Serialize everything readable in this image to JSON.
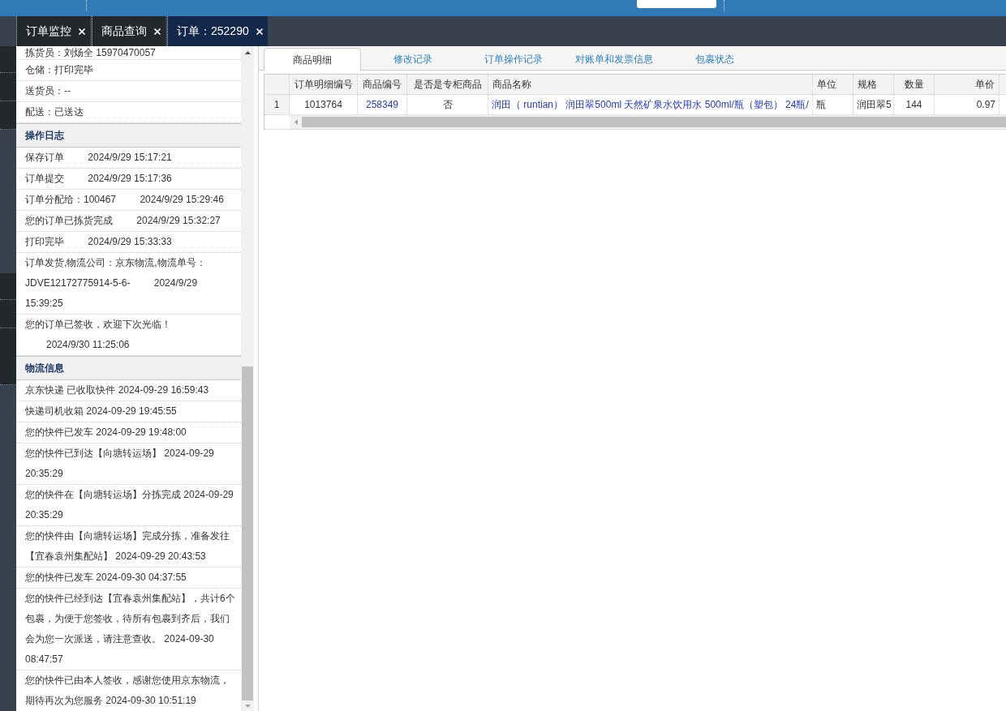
{
  "top_tabs": [
    {
      "label": "订单监控",
      "selected": false
    },
    {
      "label": "商品查询",
      "selected": false
    },
    {
      "label": "订单：252290",
      "selected": true
    }
  ],
  "order_status": [
    "拣货员：刘炀全 15970470057",
    "仓储：打印完毕",
    "送货员：--",
    "配送：已送达"
  ],
  "operation_log": {
    "title": "操作日志",
    "entries": [
      {
        "action": "保存订单",
        "time": "2024/9/29 15:17:21"
      },
      {
        "action": "订单提交",
        "time": "2024/9/29 15:17:36"
      },
      {
        "action": "订单分配给：100467",
        "time": "2024/9/29 15:29:46"
      },
      {
        "action": "您的订单已拣货完成",
        "time": "2024/9/29 15:32:27"
      },
      {
        "action": "打印完毕",
        "time": "2024/9/29 15:33:33"
      },
      {
        "action": "订单发货,物流公司：京东物流,物流单号：JDVE12172775914-5-6-",
        "time": "2024/9/29 15:39:25"
      },
      {
        "action": "您的订单已签收，欢迎下次光临！",
        "time": "2024/9/30 11:25:06"
      }
    ]
  },
  "logistics": {
    "title": "物流信息",
    "entries": [
      {
        "description": "京东快递 已收取快件",
        "time": "2024-09-29 16:59:43"
      },
      {
        "description": "快递司机收箱",
        "time": "2024-09-29 19:45:55"
      },
      {
        "description": "您的快件已发车",
        "time": "2024-09-29 19:48:00"
      },
      {
        "description": "您的快件已到达【向塘转运场】",
        "time": "2024-09-29 20:35:29"
      },
      {
        "description": "您的快件在【向塘转运场】分拣完成",
        "time": "2024-09-29 20:35:29"
      },
      {
        "description": "您的快件由【向塘转运场】完成分拣，准备发往【宜春袁州集配站】",
        "time": "2024-09-29 20:43:53"
      },
      {
        "description": "您的快件已发车",
        "time": "2024-09-30 04:37:55"
      },
      {
        "description": "您的快件已经到达【宜春袁州集配站】，共计6个包裹，为便于您签收，待所有包裹到齐后，我们会为您一次派送，请注意查收。",
        "time": "2024-09-30 08:47:57"
      },
      {
        "description": "您的快件已由本人签收，感谢您使用京东物流，期待再次为您服务",
        "time": "2024-09-30 10:51:19"
      }
    ]
  },
  "detail_tabs": [
    {
      "label": "商品明细",
      "selected": true
    },
    {
      "label": "修改记录",
      "selected": false
    },
    {
      "label": "订单操作记录",
      "selected": false
    },
    {
      "label": "对账单和发票信息",
      "selected": false
    },
    {
      "label": "包裹状态",
      "selected": false
    }
  ],
  "items_table": {
    "columns": [
      "订单明细编号",
      "商品编号",
      "是否是专柜商品",
      "商品名称",
      "单位",
      "规格",
      "数量",
      "单价"
    ],
    "rows": [
      {
        "number": "1",
        "cells": [
          "1013764",
          "258349",
          "否",
          "润田（ runtian） 润田翠500ml 天然矿泉水饮用水 500ml/瓶（塑包） 24瓶/",
          "瓶",
          "润田翠5",
          "144",
          "0.97"
        ]
      }
    ]
  }
}
